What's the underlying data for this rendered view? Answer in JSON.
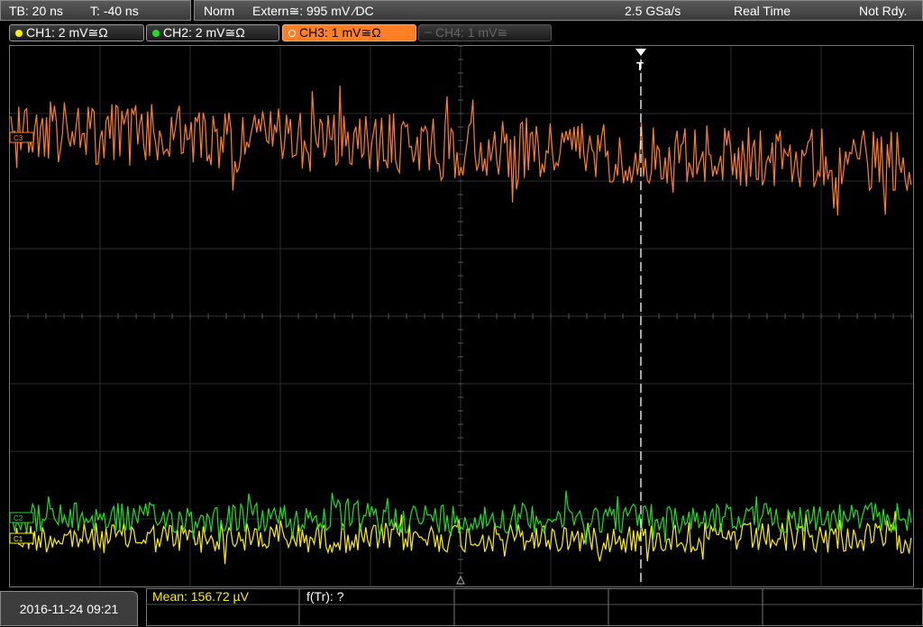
{
  "status": {
    "timebase": "TB: 20 ns",
    "trigger_time": "T: -40 ns",
    "mode": "Norm",
    "trigger_source": "Extern≅: 995 mV ⁄DC",
    "sample_rate": "2.5 GSa/s",
    "acq_mode": "Real Time",
    "state": "Not Rdy."
  },
  "channels": [
    {
      "label": "CH1: 2 mV≅Ω",
      "color": "#ffee00",
      "state": "on"
    },
    {
      "label": "CH2: 2 mV≅Ω",
      "color": "#22dd22",
      "state": "on"
    },
    {
      "label": "CH3: 1 mV≅Ω",
      "color": "#ff7f27",
      "state": "selected"
    },
    {
      "label": "CH4: 1 mV≅",
      "color": "#555555",
      "state": "off"
    }
  ],
  "markers": {
    "ch3": "C3",
    "ch2": "C2",
    "ch1": "C1",
    "trigger": "T"
  },
  "footer": {
    "datetime": "2016-11-24 09:21",
    "mean": "Mean: 156.72 µV",
    "ftr": "f(Tr): ?"
  }
}
